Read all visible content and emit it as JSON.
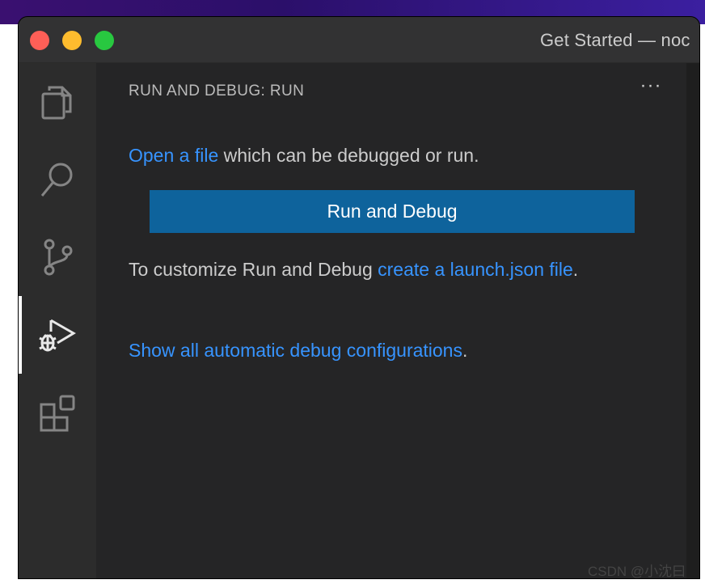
{
  "window": {
    "title": "Get Started — noc",
    "controls": {
      "close": "close-window",
      "minimize": "minimize-window",
      "maximize": "maximize-window"
    }
  },
  "activity_bar": {
    "items": [
      {
        "id": "explorer",
        "icon": "files-icon",
        "active": false
      },
      {
        "id": "search",
        "icon": "search-icon",
        "active": false
      },
      {
        "id": "source-control",
        "icon": "source-control-icon",
        "active": false
      },
      {
        "id": "run-and-debug",
        "icon": "run-debug-icon",
        "active": true
      },
      {
        "id": "extensions",
        "icon": "extensions-icon",
        "active": false
      }
    ]
  },
  "sidebar": {
    "header": "RUN AND DEBUG: RUN",
    "more_actions": "···",
    "open_file": {
      "link": "Open a file",
      "text": " which can be debugged or run."
    },
    "run_button": "Run and Debug",
    "customize": {
      "text": "To customize Run and Debug ",
      "link": "create a launch.json file",
      "suffix": "."
    },
    "show_all": {
      "link": "Show all automatic debug configurations",
      "suffix": "."
    }
  },
  "watermark": "CSDN @小沈曰",
  "colors": {
    "accent_link": "#3794ff",
    "button_bg": "#0e639c",
    "sidebar_bg": "#252526",
    "activitybar_bg": "#2c2c2c"
  }
}
